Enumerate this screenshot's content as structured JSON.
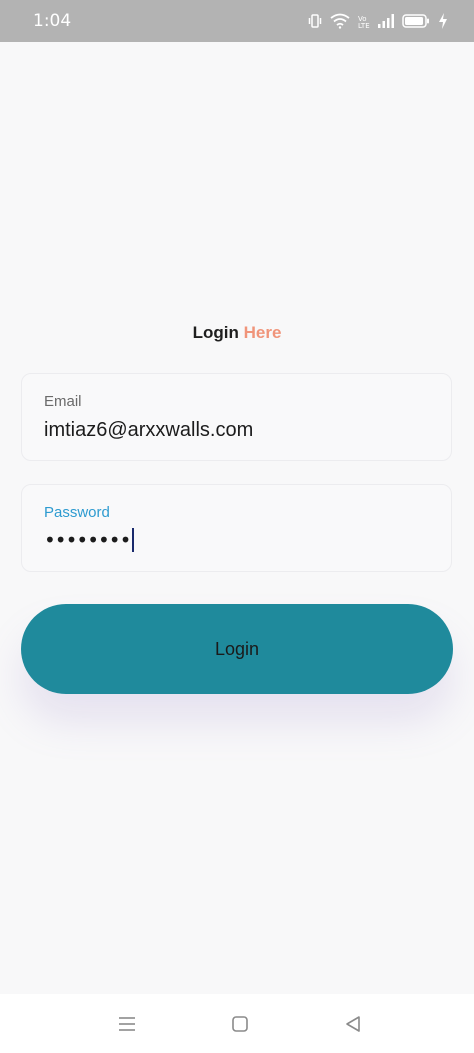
{
  "status_bar": {
    "time": "1:04",
    "icons": [
      "vibrate-icon",
      "wifi-icon",
      "volte-icon",
      "signal-icon",
      "battery-icon",
      "charging-icon"
    ]
  },
  "login": {
    "title_part1": "Login",
    "title_part2": "Here",
    "email_label": "Email",
    "email_value": "imtiaz6@arxxwalls.com",
    "password_label": "Password",
    "password_masked": "••••••••",
    "button_label": "Login"
  },
  "nav": {
    "icons": [
      "menu-icon",
      "home-icon",
      "back-icon"
    ]
  },
  "colors": {
    "accent": "#1f8a9c",
    "title_highlight": "#f0947a",
    "focus_label": "#2e9bd0",
    "status_bar_bg": "#b3b3b3"
  }
}
